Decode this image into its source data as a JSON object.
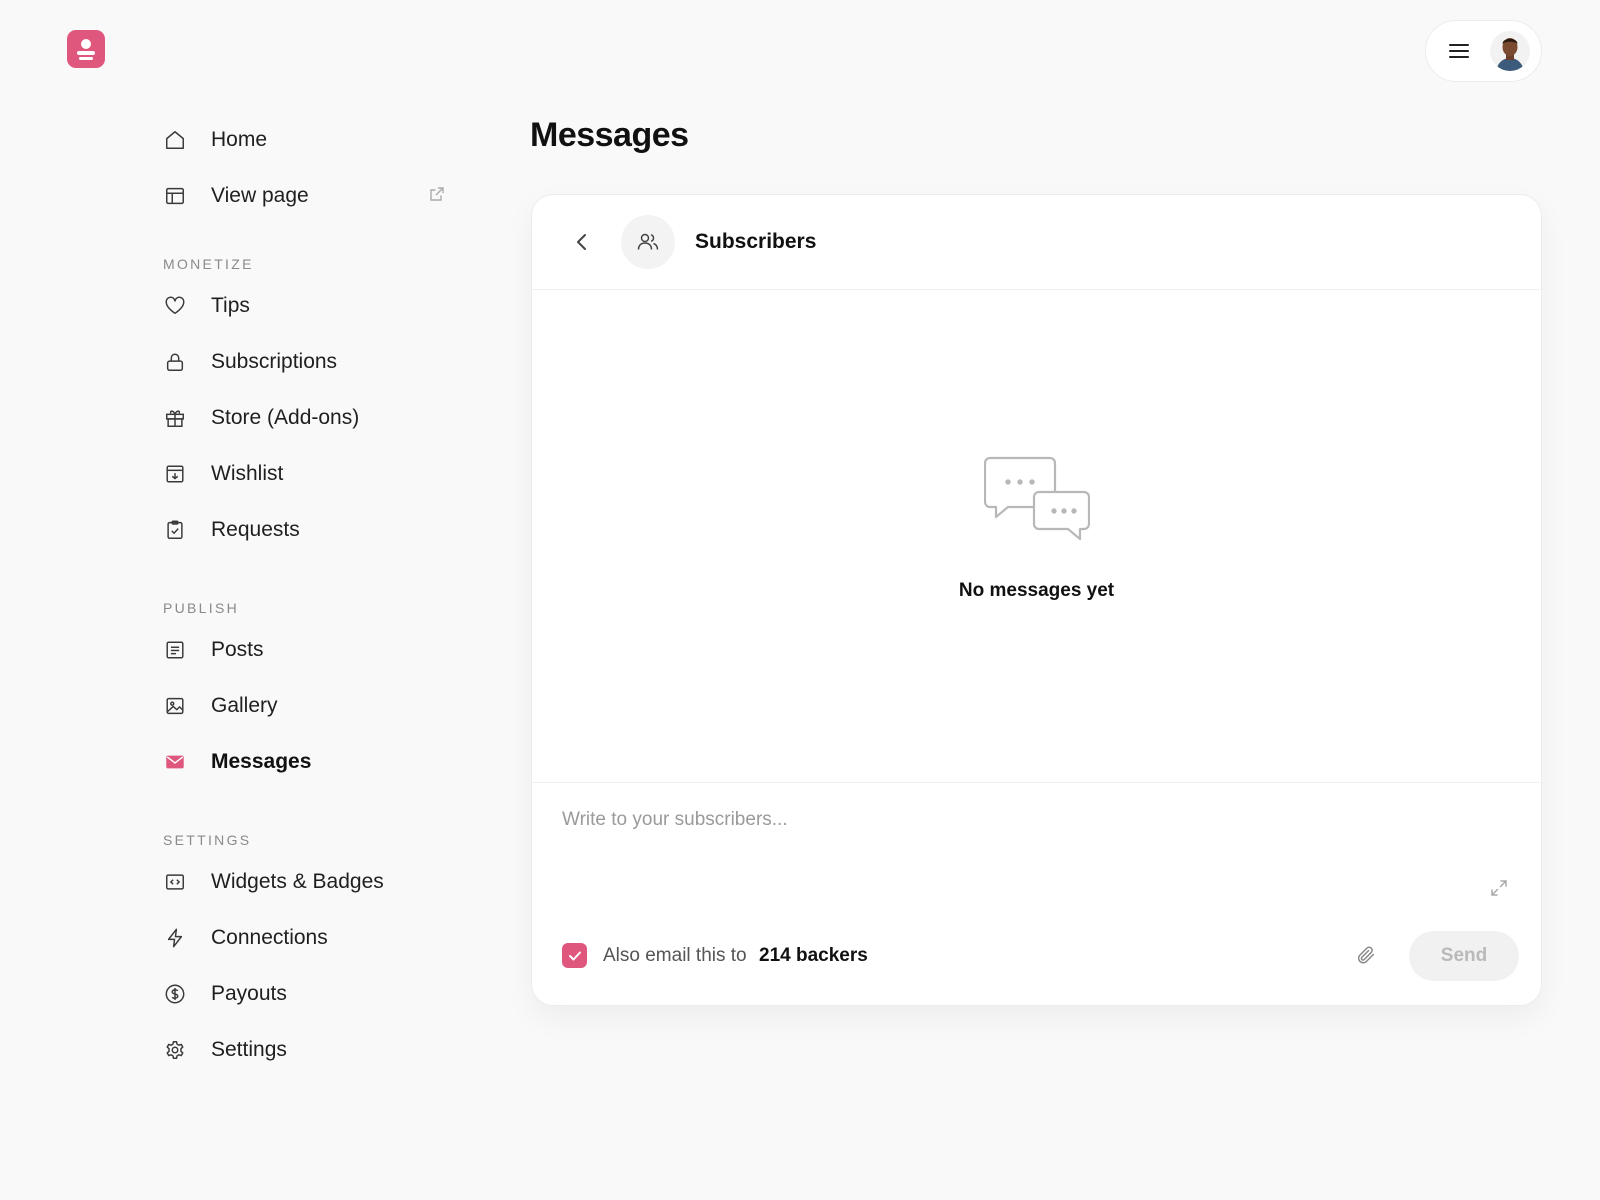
{
  "brand": {
    "accent": "#e0577e"
  },
  "header": {
    "menu_icon": "hamburger-icon",
    "avatar_alt": "profile-avatar"
  },
  "sidebar": {
    "top_items": [
      {
        "label": "Home",
        "icon": "home-icon"
      },
      {
        "label": "View page",
        "icon": "layout-icon",
        "external": true
      }
    ],
    "sections": [
      {
        "title": "MONETIZE",
        "items": [
          {
            "label": "Tips",
            "icon": "heart-icon"
          },
          {
            "label": "Subscriptions",
            "icon": "lock-icon"
          },
          {
            "label": "Store (Add-ons)",
            "icon": "gift-icon"
          },
          {
            "label": "Wishlist",
            "icon": "archive-icon"
          },
          {
            "label": "Requests",
            "icon": "clipboard-check-icon"
          }
        ]
      },
      {
        "title": "PUBLISH",
        "items": [
          {
            "label": "Posts",
            "icon": "document-icon"
          },
          {
            "label": "Gallery",
            "icon": "image-icon"
          },
          {
            "label": "Messages",
            "icon": "mail-icon",
            "active": true
          }
        ]
      },
      {
        "title": "SETTINGS",
        "items": [
          {
            "label": "Widgets & Badges",
            "icon": "code-icon"
          },
          {
            "label": "Connections",
            "icon": "bolt-icon"
          },
          {
            "label": "Payouts",
            "icon": "dollar-icon"
          },
          {
            "label": "Settings",
            "icon": "gear-icon"
          }
        ]
      }
    ]
  },
  "main": {
    "title": "Messages",
    "thread": {
      "title": "Subscribers",
      "empty_text": "No messages yet"
    },
    "composer": {
      "placeholder": "Write to your subscribers...",
      "email_label": "Also email this to",
      "backers": "214 backers",
      "email_checked": true,
      "send_label": "Send"
    }
  }
}
